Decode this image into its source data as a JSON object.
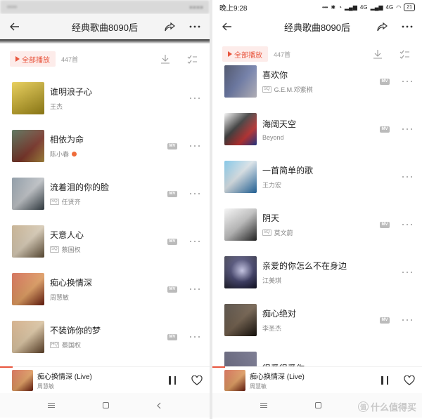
{
  "colors": {
    "accent": "#e8553d",
    "text": "#222222",
    "subtext": "#888888"
  },
  "left": {
    "header": {
      "title": "经典歌曲8090后"
    },
    "actions": {
      "play_all": "全部播放",
      "count": "447首"
    },
    "songs": [
      {
        "title": "谁明浪子心",
        "artist": "王杰",
        "quality": "",
        "mv": false,
        "hot": false
      },
      {
        "title": "相依为命",
        "artist": "陈小春",
        "quality": "",
        "mv": true,
        "hot": true
      },
      {
        "title": "流着泪的你的脸",
        "artist": "任贤齐",
        "quality": "SQ",
        "mv": true,
        "hot": false
      },
      {
        "title": "天意人心",
        "artist": "蔡国权",
        "quality": "SQ",
        "mv": true,
        "hot": false
      },
      {
        "title": "痴心换情深",
        "artist": "周慧敏",
        "quality": "",
        "mv": true,
        "hot": false
      },
      {
        "title": "不装饰你的梦",
        "artist": "蔡国权",
        "quality": "HQ",
        "mv": true,
        "hot": false
      }
    ],
    "player": {
      "title": "痴心换情深 (Live)",
      "artist": "周慧敏",
      "progress": 0.06
    }
  },
  "right": {
    "status": {
      "time": "晚上9:28",
      "network": "4G",
      "network2": "4G",
      "battery": "21"
    },
    "header": {
      "title": "经典歌曲8090后"
    },
    "actions": {
      "play_all": "全部播放",
      "count": "447首"
    },
    "songs": [
      {
        "title": "喜欢你",
        "artist": "G.E.M.邓紫棋",
        "quality": "SQ",
        "mv": true
      },
      {
        "title": "海阔天空",
        "artist": "Beyond",
        "quality": "",
        "mv": true
      },
      {
        "title": "一首简单的歌",
        "artist": "王力宏",
        "quality": "",
        "mv": false
      },
      {
        "title": "阴天",
        "artist": "莫文蔚",
        "quality": "SQ",
        "mv": true
      },
      {
        "title": "亲爱的你怎么不在身边",
        "artist": "江美琪",
        "quality": "",
        "mv": false
      },
      {
        "title": "痴心绝对",
        "artist": "李圣杰",
        "quality": "",
        "mv": true
      },
      {
        "title": "很爱很爱你",
        "artist": "",
        "quality": "",
        "mv": false
      }
    ],
    "player": {
      "title": "痴心换情深 (Live)",
      "artist": "周慧敏",
      "progress": 0.06
    }
  },
  "watermark": {
    "text": "值 什么值得买"
  }
}
